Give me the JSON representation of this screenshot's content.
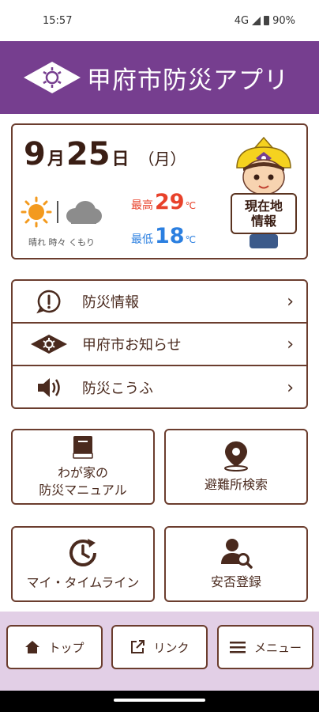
{
  "status_bar": {
    "time": "15:57",
    "network": "4G",
    "battery": "90%"
  },
  "header": {
    "app_title": "甲府市防災アプリ"
  },
  "weather": {
    "month": "9",
    "month_unit": "月",
    "day": "25",
    "day_unit": "日",
    "weekday": "（月）",
    "condition_text": "晴れ 時々 くもり",
    "high_label": "最高",
    "high_value": "29",
    "low_label": "最低",
    "low_value": "18",
    "temp_unit": "℃",
    "location_button_line1": "現在地",
    "location_button_line2": "情報",
    "high_color": "#e8412a",
    "low_color": "#2b7fe0"
  },
  "menu": [
    {
      "label": "防災情報",
      "icon": "alert-circle-icon"
    },
    {
      "label": "甲府市お知らせ",
      "icon": "city-emblem-icon"
    },
    {
      "label": "防災こうふ",
      "icon": "speaker-icon"
    }
  ],
  "tiles": [
    {
      "line1": "わが家の",
      "line2": "防災マニュアル",
      "icon": "book-icon"
    },
    {
      "line1": "避難所検索",
      "icon": "map-pin-icon"
    },
    {
      "line1": "マイ・タイムライン",
      "icon": "clock-refresh-icon"
    },
    {
      "line1": "安否登録",
      "icon": "person-search-icon"
    }
  ],
  "bottom_nav": [
    {
      "label": "トップ",
      "icon": "home-icon"
    },
    {
      "label": "リンク",
      "icon": "external-link-icon"
    },
    {
      "label": "メニュー",
      "icon": "hamburger-icon"
    }
  ],
  "colors": {
    "header": "#763e8f",
    "border": "#6b3d2e",
    "bottom_bar": "#e2cfe6"
  }
}
